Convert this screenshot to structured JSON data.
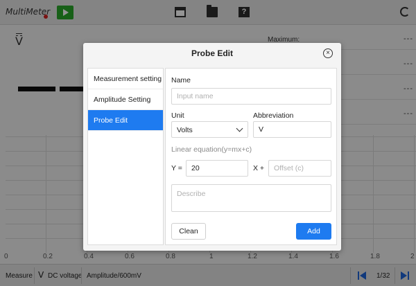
{
  "app": {
    "brand": "MultiMeter",
    "vsymbol": "V",
    "stats": {
      "maximum_label": "Maximum:",
      "maximum_value": "---",
      "row2_value": "---",
      "row3_value": "---",
      "row4_value": "---"
    },
    "axis_ticks": [
      "0",
      "0.2",
      "0.4",
      "0.6",
      "0.8",
      "1",
      "1.2",
      "1.4",
      "1.6",
      "1.8",
      "2"
    ],
    "statusbar": {
      "measure": "Measure",
      "v_symbol": "V",
      "dc_voltage": "DC voltage",
      "amplitude": "Amplitude/600mV",
      "page": "1/32"
    }
  },
  "dialog": {
    "title": "Probe Edit",
    "close_glyph": "×",
    "menu": [
      {
        "label": "Measurement setting"
      },
      {
        "label": "Amplitude Setting"
      },
      {
        "label": "Probe Edit"
      }
    ],
    "form": {
      "name_label": "Name",
      "name_placeholder": "Input name",
      "unit_label": "Unit",
      "unit_value": "Volts",
      "abbrev_label": "Abbreviation",
      "abbrev_value": "V",
      "equation_label": "Linear equation(y=mx+c)",
      "y_label": "Y =",
      "m_value": "20",
      "x_label": "X +",
      "offset_placeholder": "Offset (c)",
      "describe_placeholder": "Describe",
      "clean_label": "Clean",
      "add_label": "Add"
    }
  }
}
